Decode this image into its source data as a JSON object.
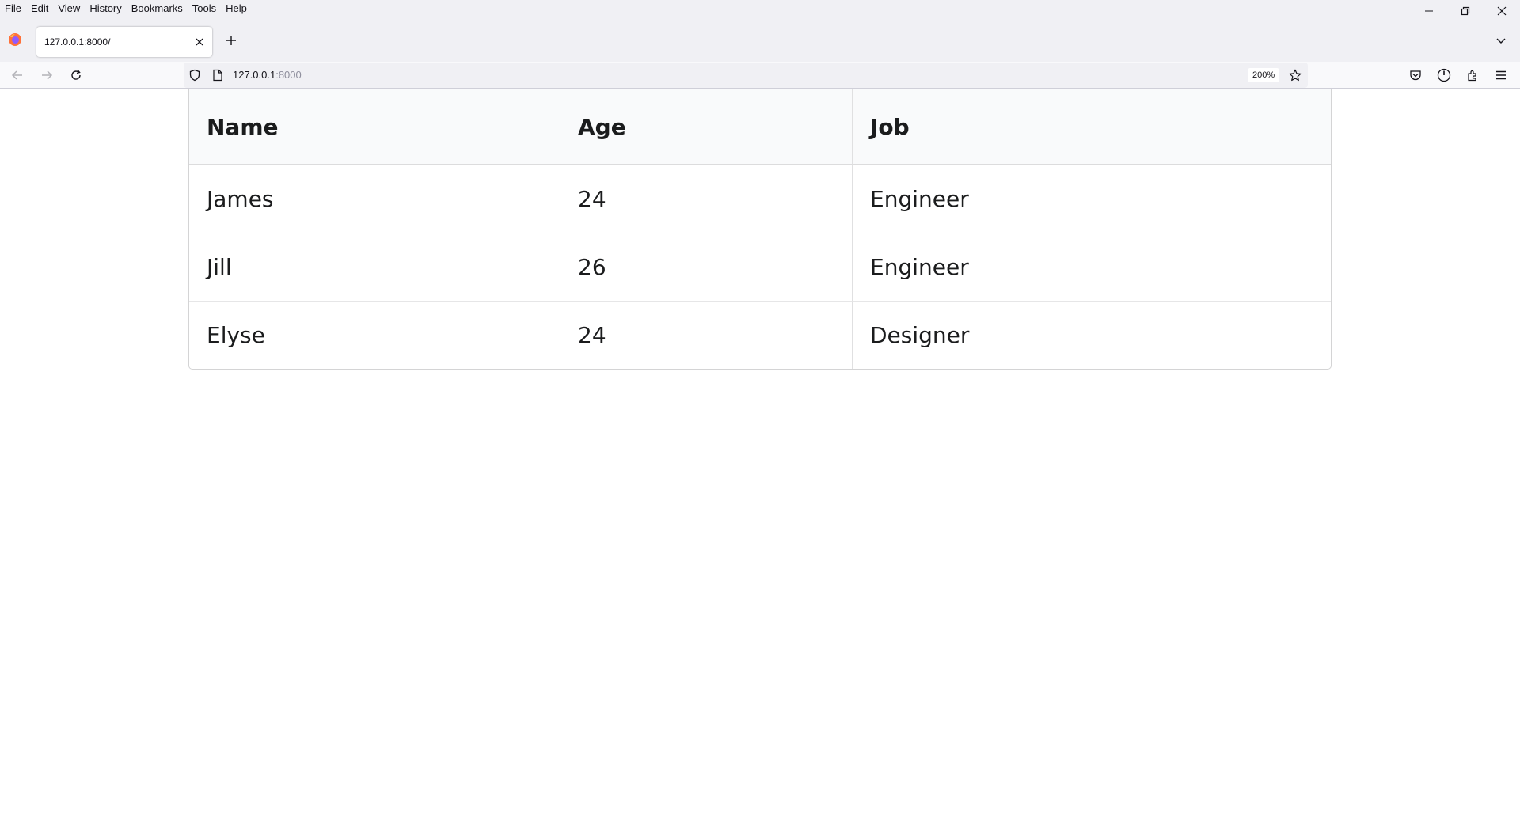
{
  "menu": [
    "File",
    "Edit",
    "View",
    "History",
    "Bookmarks",
    "Tools",
    "Help"
  ],
  "tab": {
    "title": "127.0.0.1:8000/"
  },
  "address": {
    "host": "127.0.0.1",
    "port": ":8000",
    "zoom": "200%"
  },
  "table": {
    "headers": [
      "Name",
      "Age",
      "Job"
    ],
    "rows": [
      [
        "James",
        "24",
        "Engineer"
      ],
      [
        "Jill",
        "26",
        "Engineer"
      ],
      [
        "Elyse",
        "24",
        "Designer"
      ]
    ]
  },
  "colors": {
    "chrome": "#f0f0f4",
    "header_bg": "#f9fafb",
    "border": "#d4d4d5"
  }
}
